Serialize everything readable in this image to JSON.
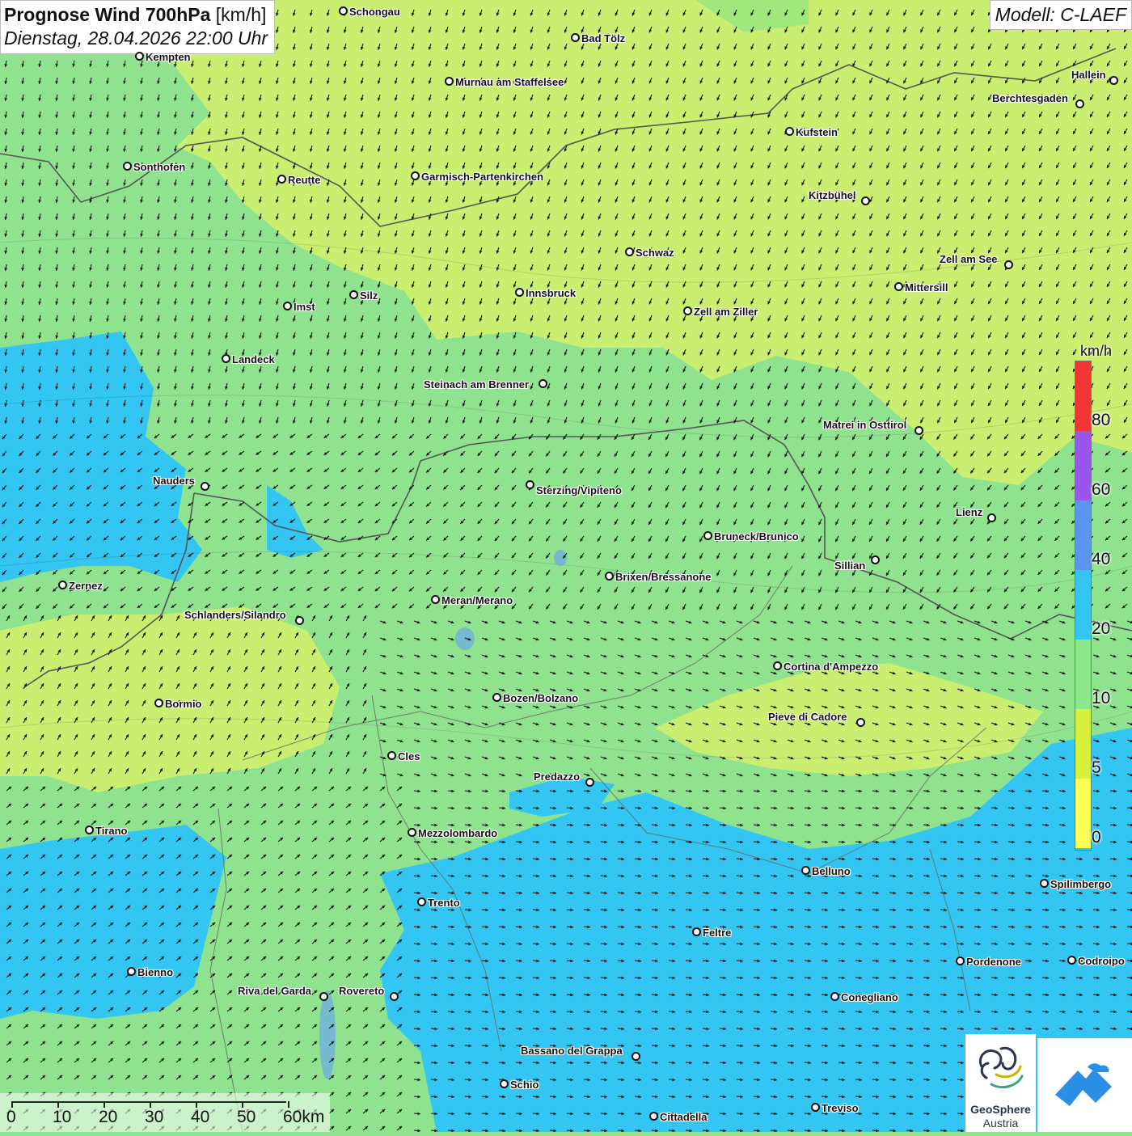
{
  "header": {
    "title_bold": "Prognose Wind 700hPa",
    "title_unit": " [km/h]",
    "datetime": "Dienstag, 28.04.2026 22:00 Uhr",
    "model": "Modell: C-LAEF"
  },
  "legend": {
    "unit": "km/h",
    "segments": [
      {
        "label": "0",
        "color": "#ffff55"
      },
      {
        "label": "5",
        "color": "#d6f03c"
      },
      {
        "label": "10",
        "color": "#8be88b"
      },
      {
        "label": "20",
        "color": "#33c6f2"
      },
      {
        "label": "40",
        "color": "#5c95ef"
      },
      {
        "label": "60",
        "color": "#9a55ea"
      },
      {
        "label": "80",
        "color": "#f23636"
      }
    ]
  },
  "scale_bar": {
    "labels": [
      "0",
      "10",
      "20",
      "30",
      "40",
      "50",
      "60km"
    ]
  },
  "cities": [
    {
      "name": "Schongau"
    },
    {
      "name": "Bad Tölz"
    },
    {
      "name": "Kempten"
    },
    {
      "name": "Murnau am Staffelsee"
    },
    {
      "name": "Hallein"
    },
    {
      "name": "Berchtesgaden"
    },
    {
      "name": "Kufstein"
    },
    {
      "name": "Sonthofen"
    },
    {
      "name": "Reutte"
    },
    {
      "name": "Garmisch-Partenkirchen"
    },
    {
      "name": "Kitzbühel"
    },
    {
      "name": "Schwaz"
    },
    {
      "name": "Zell am See"
    },
    {
      "name": "Mittersill"
    },
    {
      "name": "Silz"
    },
    {
      "name": "Innsbruck"
    },
    {
      "name": "Imst"
    },
    {
      "name": "Zell am Ziller"
    },
    {
      "name": "Landeck"
    },
    {
      "name": "Steinach am Brenner"
    },
    {
      "name": "Matrei in Osttirol"
    },
    {
      "name": "Nauders"
    },
    {
      "name": "Sterzing/Vipiteno"
    },
    {
      "name": "Lienz"
    },
    {
      "name": "Bruneck/Brunico"
    },
    {
      "name": "Sillian"
    },
    {
      "name": "Zernez"
    },
    {
      "name": "Brixen/Bressanone"
    },
    {
      "name": "Meran/Merano"
    },
    {
      "name": "Schlanders/Silandro"
    },
    {
      "name": "Cortina d'Ampezzo"
    },
    {
      "name": "Bozen/Bolzano"
    },
    {
      "name": "Bormio"
    },
    {
      "name": "Pieve di Cadore"
    },
    {
      "name": "Cles"
    },
    {
      "name": "Predazzo"
    },
    {
      "name": "Tirano"
    },
    {
      "name": "Mezzolombardo"
    },
    {
      "name": "Belluno"
    },
    {
      "name": "Spilimbergo"
    },
    {
      "name": "Trento"
    },
    {
      "name": "Feltre"
    },
    {
      "name": "Pordenone"
    },
    {
      "name": "Codroipo"
    },
    {
      "name": "Bienno"
    },
    {
      "name": "Riva del Garda"
    },
    {
      "name": "Rovereto"
    },
    {
      "name": "Conegliano"
    },
    {
      "name": "Bassano del Grappa"
    },
    {
      "name": "Schio"
    },
    {
      "name": "Treviso"
    },
    {
      "name": "Cittadella"
    }
  ],
  "logos": {
    "geosphere_line1": "GeoSphere",
    "geosphere_line2": "Austria"
  }
}
